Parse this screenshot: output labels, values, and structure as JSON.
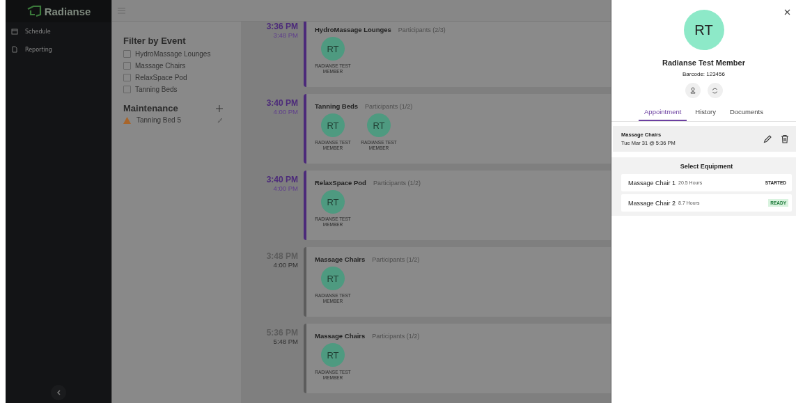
{
  "sidebar": {
    "logo": "Radianse",
    "items": [
      {
        "label": "Schedule",
        "selected": false
      },
      {
        "label": "Reporting",
        "selected": false
      }
    ]
  },
  "filter": {
    "title": "Filter by Event",
    "options": [
      {
        "label": "HydroMassage Lounges",
        "checked": false
      },
      {
        "label": "Massage Chairs",
        "checked": false
      },
      {
        "label": "RelaxSpace Pod",
        "checked": false
      },
      {
        "label": "Tanning Beds",
        "checked": false
      }
    ]
  },
  "maintenance": {
    "title": "Maintenance",
    "items": [
      {
        "label": "Tanning Bed 5"
      }
    ]
  },
  "events": [
    {
      "start": "3:36 PM",
      "end": "3:48 PM",
      "active": true,
      "title": "HydroMassage Lounges",
      "participants": "Participants (2/3)",
      "members": [
        {
          "initials": "RT",
          "name": "RADIANSE TEST MEMBER"
        }
      ]
    },
    {
      "start": "3:40 PM",
      "end": "4:00 PM",
      "active": true,
      "title": "Tanning Beds",
      "participants": "Participants (1/2)",
      "members": [
        {
          "initials": "RT",
          "name": "RADIANSE TEST MEMBER"
        },
        {
          "initials": "RT",
          "name": "RADIANSE TEST MEMBER"
        }
      ]
    },
    {
      "start": "3:40 PM",
      "end": "4:00 PM",
      "active": true,
      "title": "RelaxSpace Pod",
      "participants": "Participants (1/2)",
      "members": [
        {
          "initials": "RT",
          "name": "RADIANSE TEST MEMBER"
        }
      ]
    },
    {
      "start": "3:48 PM",
      "end": "4:00 PM",
      "active": false,
      "title": "Massage Chairs",
      "participants": "Participants (1/2)",
      "members": [
        {
          "initials": "RT",
          "name": "RADIANSE TEST MEMBER"
        }
      ]
    },
    {
      "start": "5:36 PM",
      "end": "5:48 PM",
      "active": false,
      "title": "Massage Chairs",
      "participants": "Participants (1/2)",
      "members": [
        {
          "initials": "RT",
          "name": "RADIANSE TEST MEMBER"
        }
      ]
    }
  ],
  "member": {
    "initials": "RT",
    "name": "Radianse Test Member",
    "barcode": "Barcode: 123456"
  },
  "tabs": [
    {
      "label": "Appointment",
      "selected": true
    },
    {
      "label": "History",
      "selected": false
    },
    {
      "label": "Documents",
      "selected": false
    }
  ],
  "appointment": {
    "title": "Massage Chairs",
    "when": "Tue Mar 31 @ 5:36 PM"
  },
  "equipment": {
    "title": "Select Equipment",
    "items": [
      {
        "name": "Massage Chair 1",
        "hours": "20.5 Hours",
        "status": "STARTED",
        "kind": "started"
      },
      {
        "name": "Massage Chair 2",
        "hours": "8.7 Hours",
        "status": "READY",
        "kind": "ready"
      }
    ]
  }
}
